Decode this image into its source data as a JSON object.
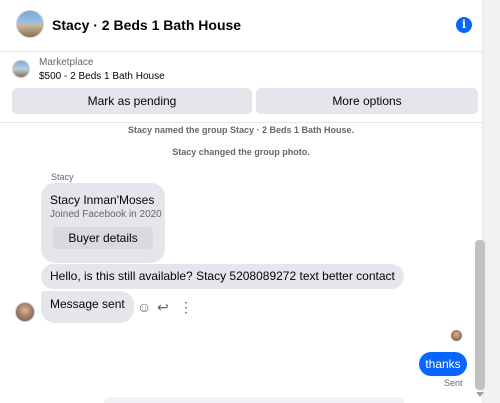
{
  "header": {
    "title": "Stacy · 2 Beds 1 Bath House",
    "info_icon_label": "i"
  },
  "listing": {
    "source": "Marketplace",
    "item": "$500 - 2 Beds 1 Bath House",
    "mark_pending_label": "Mark as pending",
    "more_options_label": "More options"
  },
  "chat": {
    "system_messages": [
      "Stacy named the group Stacy · 2 Beds 1 Bath House.",
      "Stacy changed the group photo."
    ],
    "sender_name": "Stacy",
    "profile_card": {
      "name": "Stacy Inman'Moses",
      "joined": "Joined Facebook in 2020",
      "button_label": "Buyer details"
    },
    "incoming": [
      "Hello, is this still available? Stacy 5208089272 text better contact",
      "Message sent"
    ],
    "outgoing": {
      "text": "thanks",
      "status": "Sent"
    },
    "actions": {
      "react_icon": "☺",
      "reply_icon": "↩",
      "more_icon": "⋮"
    }
  },
  "colors": {
    "accent": "#0866ff",
    "bubble_incoming": "#e4e6eb",
    "secondary_text": "#65676b"
  }
}
